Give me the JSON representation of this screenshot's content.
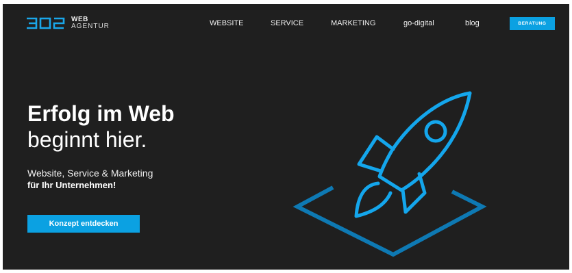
{
  "header": {
    "logo": {
      "mark": "302",
      "line1": "WEB",
      "line2": "AGENTUR"
    },
    "nav": [
      {
        "label": "WEBSITE"
      },
      {
        "label": "SERVICE"
      },
      {
        "label": "MARKETING"
      },
      {
        "label": "go-digital"
      },
      {
        "label": "blog"
      }
    ],
    "cta_label": "BERATUNG"
  },
  "hero": {
    "headline_bold": "Erfolg im Web",
    "headline_light": "beginnt hier.",
    "subline": "Website, Service & Marketing",
    "subline_bold": "für Ihr Unternehmen!",
    "cta_label": "Konzept entdecken",
    "illustration_icon": "rocket-icon"
  },
  "colors": {
    "background": "#1f1f1f",
    "accent": "#0ba1e2",
    "text": "#ffffff"
  }
}
